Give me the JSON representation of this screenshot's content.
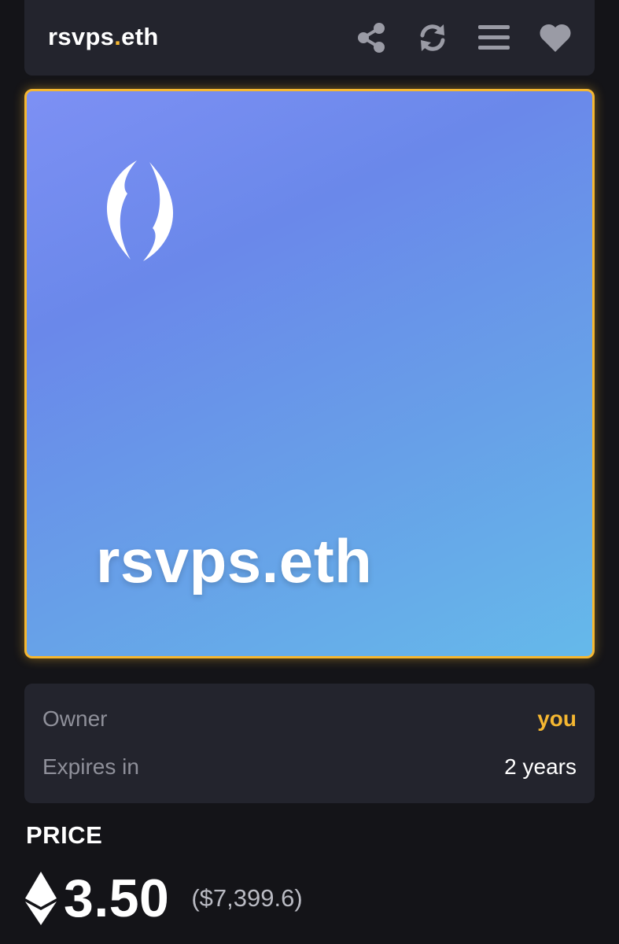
{
  "header": {
    "title_name": "rsvps",
    "title_dot": ".",
    "title_tld": "eth",
    "icons": [
      "share-icon",
      "refresh-icon",
      "menu-icon",
      "heart-icon"
    ]
  },
  "nft": {
    "display_name": "rsvps.eth",
    "logo": "ens-logo-icon",
    "gradient": [
      "#7d90f4",
      "#6a88ea",
      "#65b9ea"
    ],
    "border_color": "#f5b731"
  },
  "info": {
    "owner_label": "Owner",
    "owner_value": "you",
    "expires_label": "Expires in",
    "expires_value": "2 years"
  },
  "price": {
    "label": "PRICE",
    "currency_icon": "eth-icon",
    "value": "3.50",
    "usd": "($7,399.6)"
  },
  "colors": {
    "accent": "#f5b731",
    "background": "#141418",
    "card": "#23242d"
  }
}
